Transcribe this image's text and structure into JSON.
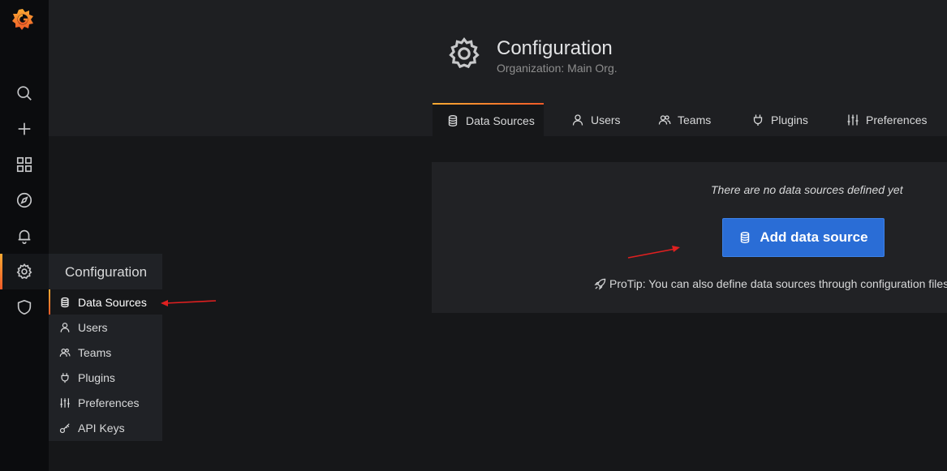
{
  "header": {
    "title": "Configuration",
    "subtitle": "Organization: Main Org."
  },
  "tabs": [
    {
      "label": "Data Sources",
      "icon": "database-icon",
      "active": true
    },
    {
      "label": "Users",
      "icon": "user-icon"
    },
    {
      "label": "Teams",
      "icon": "users-icon"
    },
    {
      "label": "Plugins",
      "icon": "plug-icon"
    },
    {
      "label": "Preferences",
      "icon": "sliders-icon"
    }
  ],
  "main": {
    "empty_message": "There are no data sources defined yet",
    "add_button_label": "Add data source",
    "protip": "ProTip: You can also define data sources through configuration files"
  },
  "sidenav": {
    "items": [
      {
        "icon": "search-icon"
      },
      {
        "icon": "plus-icon"
      },
      {
        "icon": "dashboards-icon"
      },
      {
        "icon": "compass-icon"
      },
      {
        "icon": "bell-icon"
      },
      {
        "icon": "gear-icon",
        "active": true
      },
      {
        "icon": "shield-icon"
      }
    ]
  },
  "config_menu": {
    "title": "Configuration",
    "items": [
      {
        "label": "Data Sources",
        "icon": "database-icon",
        "active": true
      },
      {
        "label": "Users",
        "icon": "user-icon"
      },
      {
        "label": "Teams",
        "icon": "users-icon"
      },
      {
        "label": "Plugins",
        "icon": "plug-icon"
      },
      {
        "label": "Preferences",
        "icon": "sliders-icon"
      },
      {
        "label": "API Keys",
        "icon": "key-icon"
      }
    ]
  },
  "colors": {
    "accent_orange": "#f05a28",
    "accent_yellow": "#fbaa33",
    "primary_button": "#2a6dd6",
    "annotation_arrow": "#e02020"
  }
}
